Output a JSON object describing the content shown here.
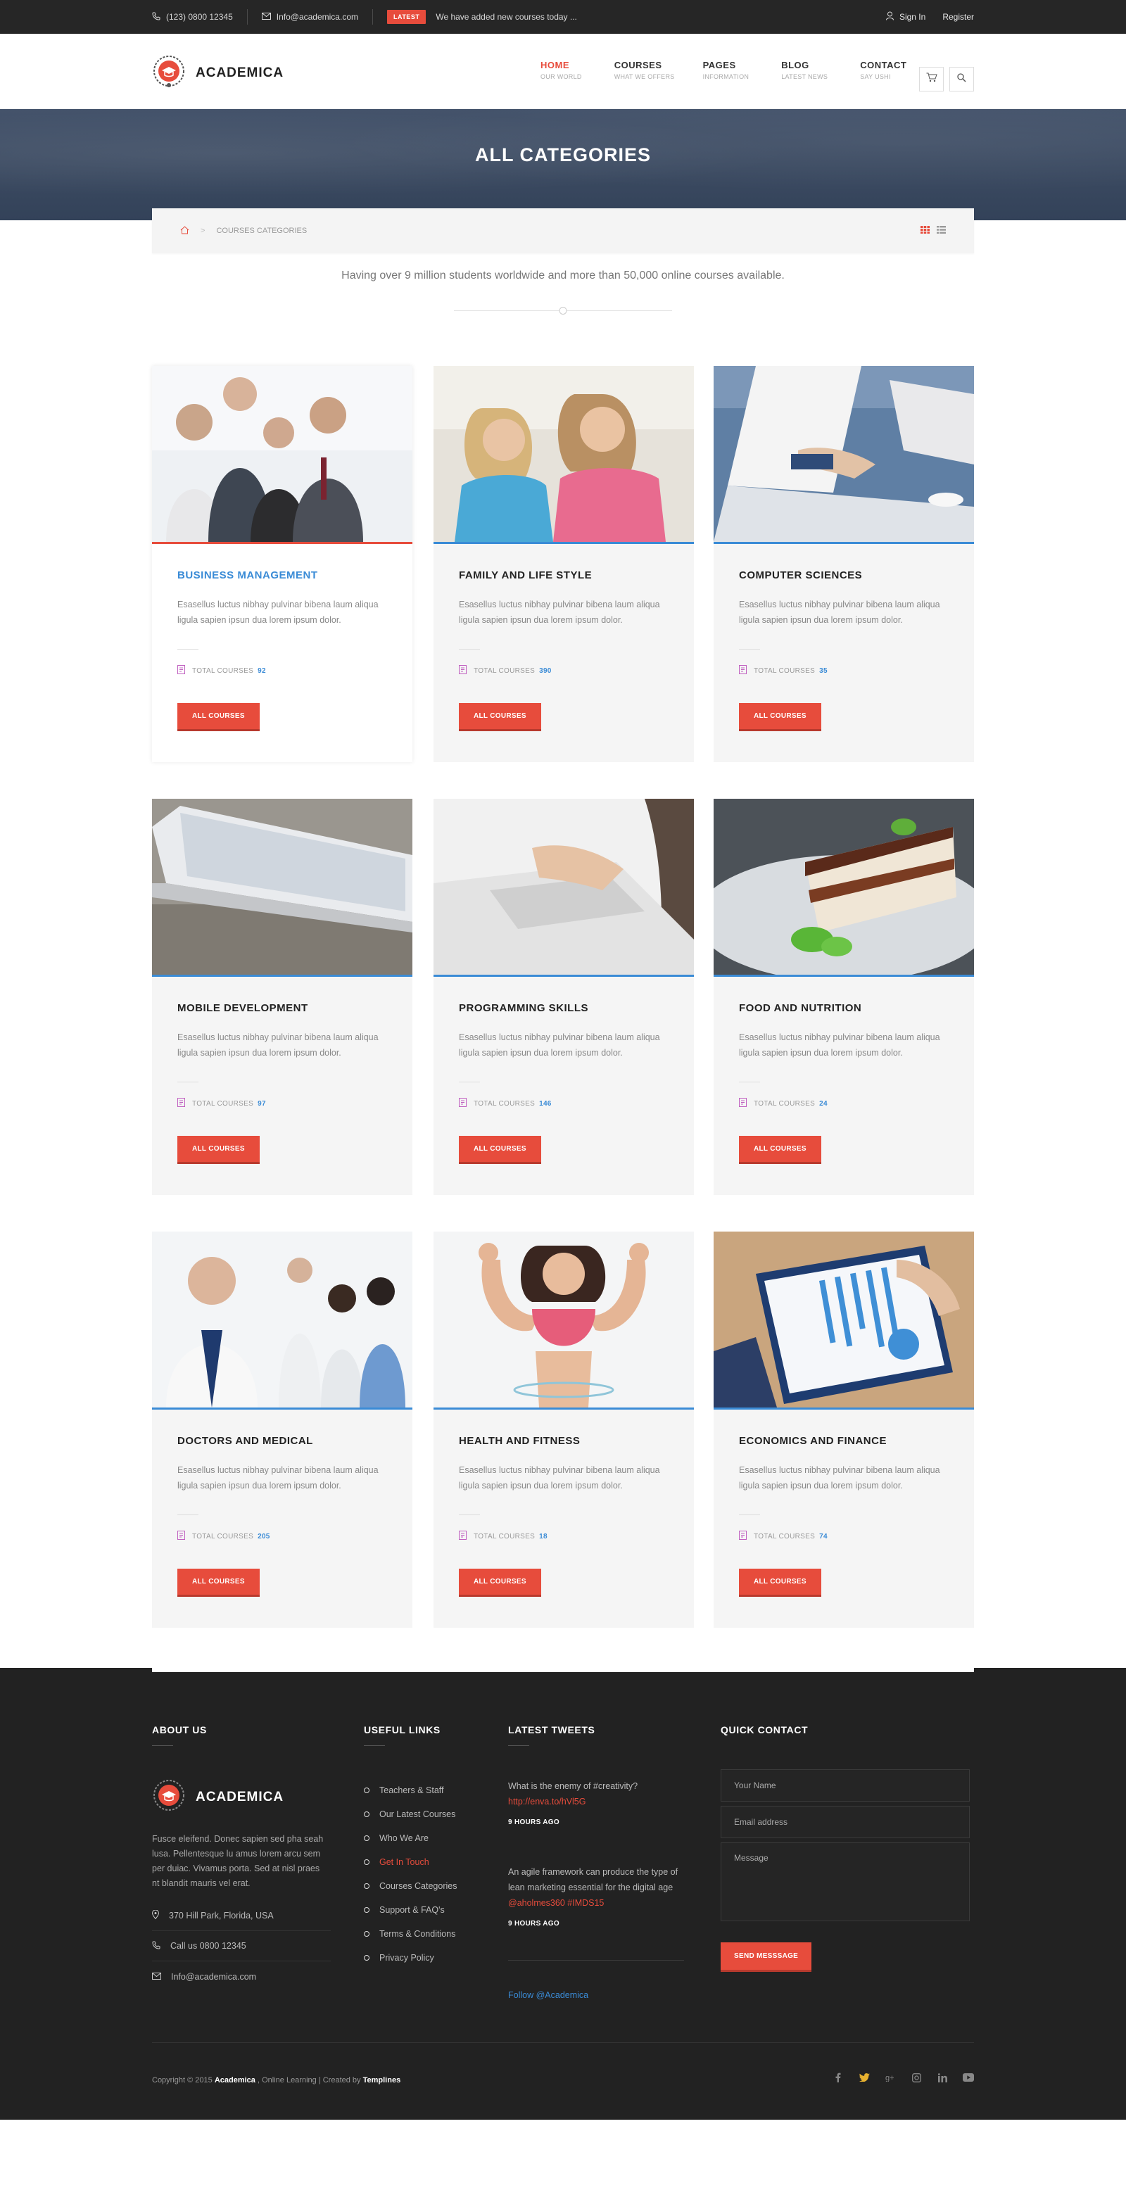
{
  "topbar": {
    "phone": "(123) 0800 12345",
    "email": "Info@academica.com",
    "latest_badge": "LATEST",
    "latest_text": "We have added new courses today ...",
    "sign_in": "Sign In",
    "register": "Register"
  },
  "brand": {
    "name": "ACADEMICA",
    "accent": "#e74c3c",
    "blue": "#3a8bd6"
  },
  "nav": [
    {
      "label": "HOME",
      "sub": "OUR WORLD",
      "active": true
    },
    {
      "label": "COURSES",
      "sub": "WHAT WE OFFERS"
    },
    {
      "label": "PAGES",
      "sub": "INFORMATION"
    },
    {
      "label": "BLOG",
      "sub": "LATEST NEWS"
    },
    {
      "label": "CONTACT",
      "sub": "SAY USHI"
    }
  ],
  "hero": {
    "title": "ALL CATEGORIES"
  },
  "breadcrumb": {
    "current": "COURSES CATEGORIES"
  },
  "intro": "Having over 9 million students worldwide and more than 50,000 online courses available.",
  "card_common": {
    "desc": "Esasellus luctus nibhay pulvinar bibena laum aliqua ligula sapien ipsun dua lorem ipsum dolor.",
    "count_label": "TOTAL COURSES",
    "button": "ALL COURSES"
  },
  "categories": [
    {
      "title": "BUSINESS MANAGEMENT",
      "count": "92",
      "featured": true,
      "image": "business-team-photo"
    },
    {
      "title": "FAMILY AND LIFE STYLE",
      "count": "390",
      "image": "family-photo"
    },
    {
      "title": "COMPUTER SCIENCES",
      "count": "35",
      "image": "laptop-photo"
    },
    {
      "title": "MOBILE DEVELOPMENT",
      "count": "97",
      "image": "smartphone-photo"
    },
    {
      "title": "PROGRAMMING SKILLS",
      "count": "146",
      "image": "keyboard-photo"
    },
    {
      "title": "FOOD AND NUTRITION",
      "count": "24",
      "image": "cake-photo"
    },
    {
      "title": "DOCTORS AND MEDICAL",
      "count": "205",
      "image": "doctors-photo"
    },
    {
      "title": "HEALTH AND FITNESS",
      "count": "18",
      "image": "fitness-photo"
    },
    {
      "title": "ECONOMICS AND FINANCE",
      "count": "74",
      "image": "finance-chart-photo"
    }
  ],
  "footer": {
    "about_title": "ABOUT US",
    "about_text": "Fusce eleifend. Donec sapien sed pha seah lusa. Pellentesque lu amus lorem arcu sem per duiac. Vivamus porta. Sed at nisl praes nt blandit mauris vel erat.",
    "address": "370 Hill Park, Florida, USA",
    "phone": "Call us 0800 12345",
    "email": "Info@academica.com",
    "links_title": "USEFUL LINKS",
    "links": [
      "Teachers & Staff",
      "Our Latest Courses",
      "Who We Are",
      "Get In Touch",
      "Courses Categories",
      "Support & FAQ's",
      "Terms & Conditions",
      "Privacy Policy"
    ],
    "tweets_title": "LATEST TWEETS",
    "tweet1_text": "What is the enemy of #creativity?",
    "tweet1_link": "http://enva.to/hVl5G",
    "tweet1_time": "9 HOURS AGO",
    "tweet2_text": "An agile framework can produce the type of lean marketing essential for the digital age",
    "tweet2_link": "@aholmes360 #IMDS15",
    "tweet2_time": "9 HOURS AGO",
    "follow": "Follow @Academica",
    "contact_title": "QUICK CONTACT",
    "name_ph": "Your Name",
    "email_ph": "Email address",
    "msg_ph": "Message",
    "send": "SEND MESSSAGE",
    "copy_prefix": "Copyright © 2015",
    "copy_brand": "Academica",
    "copy_mid": ", Online Learning  |  Created by",
    "copy_author": "Templines"
  }
}
